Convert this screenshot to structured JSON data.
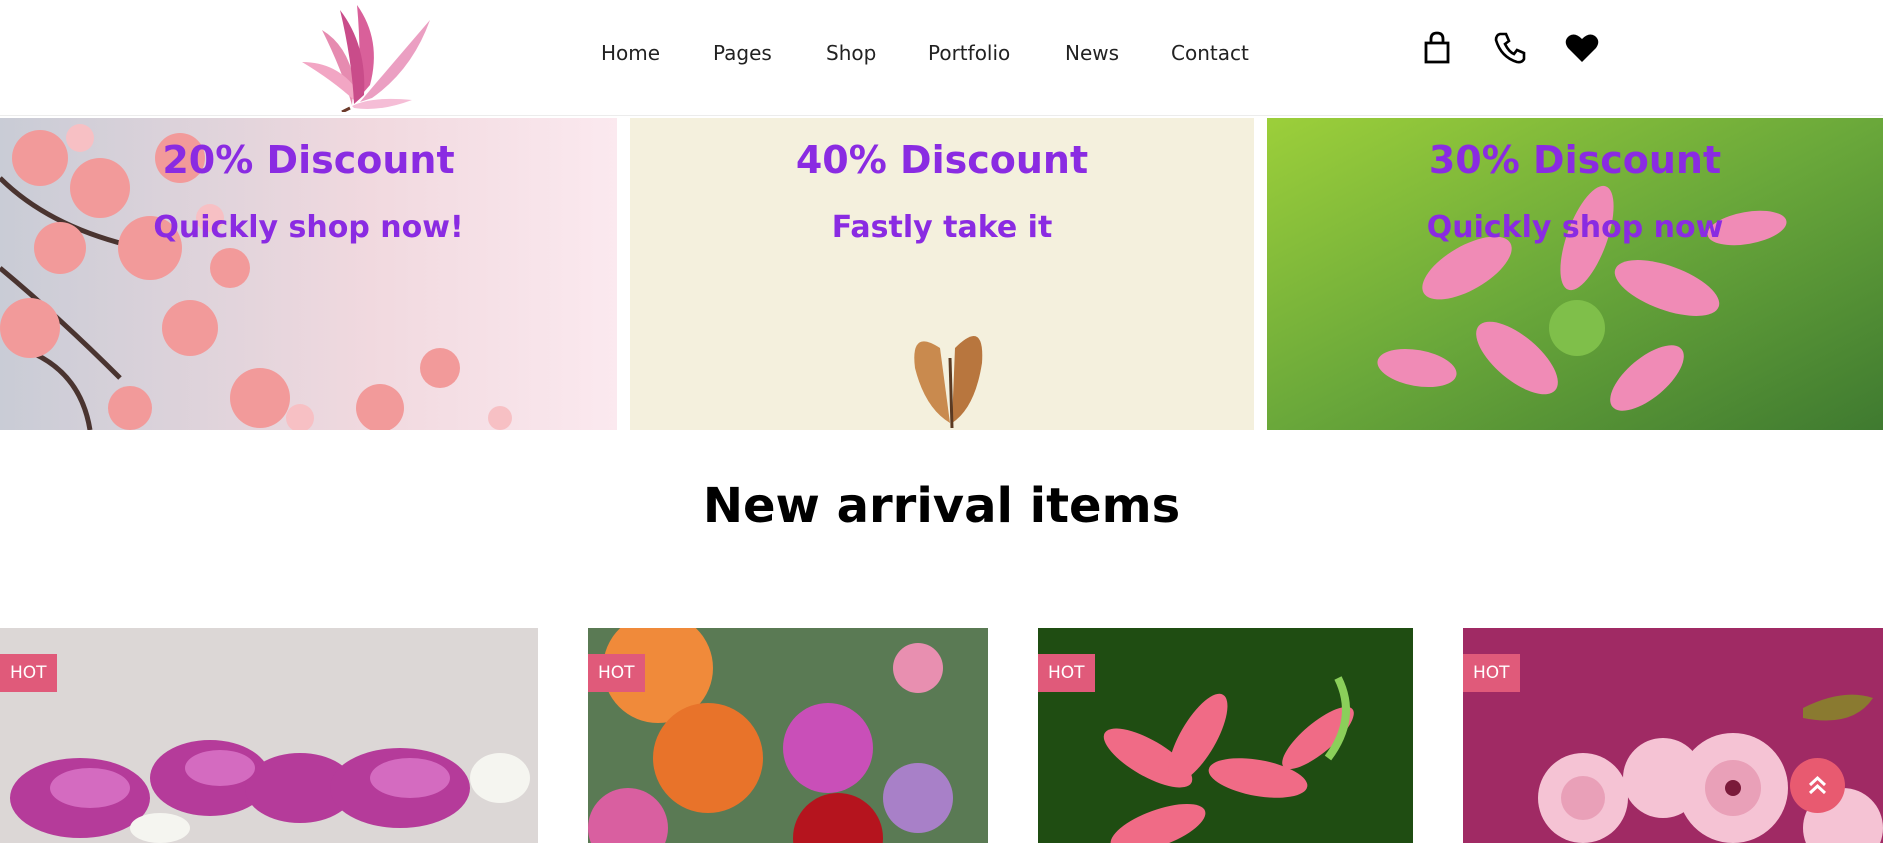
{
  "nav": {
    "items": [
      "Home",
      "Pages",
      "Shop",
      "Portfolio",
      "News",
      "Contact"
    ]
  },
  "header_icons": [
    "shopping-bag-icon",
    "phone-icon",
    "heart-icon"
  ],
  "banners": [
    {
      "title": "20% Discount",
      "subtitle": "Quickly shop now!"
    },
    {
      "title": "40% Discount",
      "subtitle": "Fastly take it"
    },
    {
      "title": "30% Discount",
      "subtitle": "Quickly shop now"
    }
  ],
  "section": {
    "title": "New arrival items"
  },
  "cards": [
    {
      "badge": "HOT"
    },
    {
      "badge": "HOT"
    },
    {
      "badge": "HOT"
    },
    {
      "badge": "HOT"
    }
  ],
  "colors": {
    "accent": "#8a2be2",
    "badge": "#e05a7a",
    "scroll_top": "#e85a70"
  }
}
